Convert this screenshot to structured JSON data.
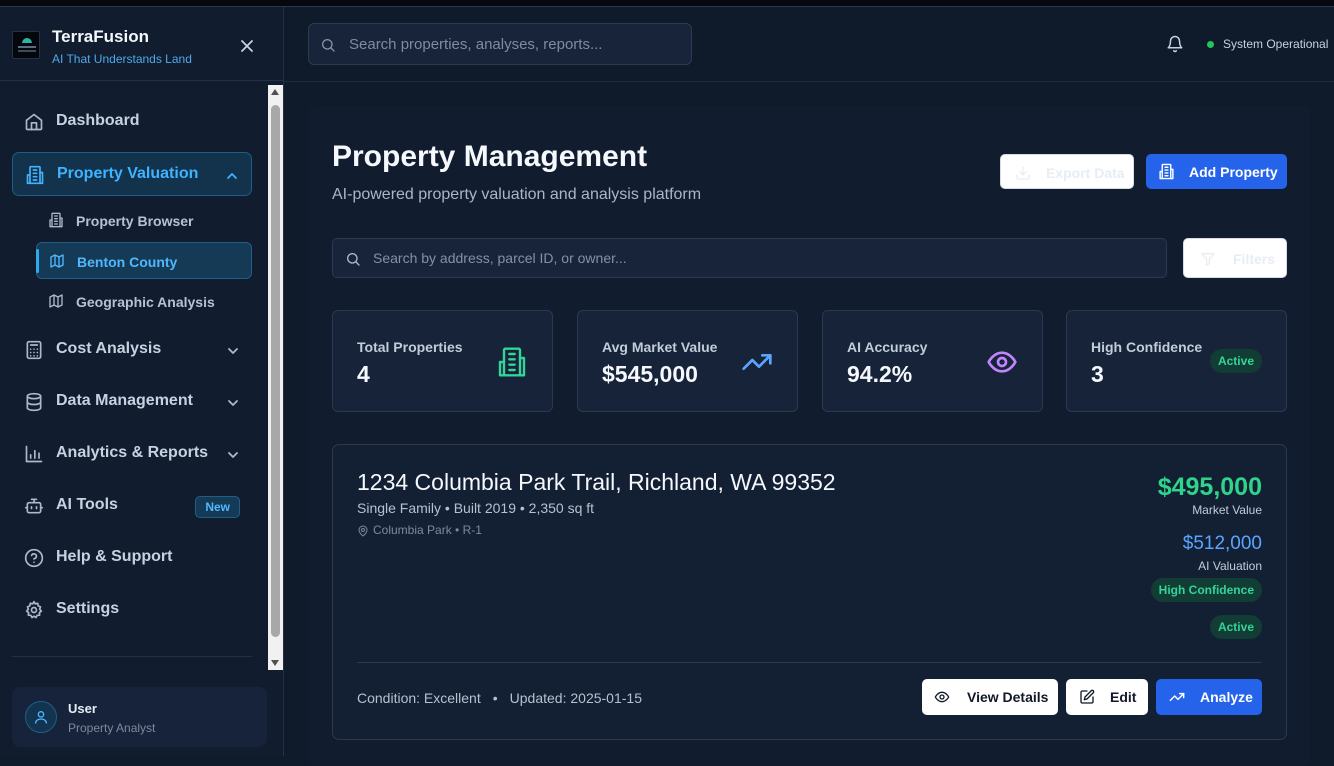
{
  "brand": {
    "title": "TerraFusion",
    "tagline": "AI That Understands Land"
  },
  "sidebar": {
    "items": [
      {
        "label": "Dashboard",
        "icon": "home-icon"
      },
      {
        "label": "Property Valuation",
        "icon": "building-icon",
        "expanded": true,
        "active": true
      },
      {
        "label": "Cost Analysis",
        "icon": "calculator-icon"
      },
      {
        "label": "Data Management",
        "icon": "database-icon"
      },
      {
        "label": "Analytics & Reports",
        "icon": "bar-chart-icon"
      },
      {
        "label": "AI Tools",
        "icon": "bot-icon",
        "badge": "New"
      },
      {
        "label": "Help & Support",
        "icon": "help-circle-icon"
      },
      {
        "label": "Settings",
        "icon": "gear-icon"
      }
    ],
    "subitems": [
      {
        "label": "Property Browser",
        "icon": "building-icon"
      },
      {
        "label": "Benton County",
        "icon": "map-icon",
        "active": true
      },
      {
        "label": "Geographic Analysis",
        "icon": "map-icon"
      }
    ],
    "user": {
      "name": "User",
      "role": "Property Analyst"
    }
  },
  "header": {
    "search_placeholder": "Search properties, analyses, reports...",
    "status": "System Operational",
    "status_color": "#22c55e"
  },
  "main": {
    "title": "Property Management",
    "subtitle": "AI-powered property valuation and analysis platform",
    "export_label": "Export Data",
    "add_label": "Add Property",
    "search_placeholder": "Search by address, parcel ID, or owner...",
    "filters_label": "Filters",
    "stats": [
      {
        "label": "Total Properties",
        "value": "4",
        "icon": "building-icon",
        "color": "#34d399"
      },
      {
        "label": "Avg Market Value",
        "value": "$545,000",
        "icon": "trending-up-icon",
        "color": "#5aa5ff"
      },
      {
        "label": "AI Accuracy",
        "value": "94.2%",
        "icon": "eye-icon",
        "color": "#c084fc"
      },
      {
        "label": "High Confidence",
        "value": "3",
        "badge": "Active"
      }
    ],
    "property": {
      "address": "1234 Columbia Park Trail, Richland, WA 99352",
      "meta": "Single Family • Built 2019 • 2,350 sq ft",
      "location": "Columbia Park • R-1",
      "market_value": "$495,000",
      "market_value_label": "Market Value",
      "ai_value": "$512,000",
      "ai_value_label": "AI Valuation",
      "confidence": "High Confidence",
      "status": "Active",
      "condition": "Condition: Excellent",
      "separator": "•",
      "updated": "Updated: 2025-01-15",
      "view_label": "View Details",
      "edit_label": "Edit",
      "analyze_label": "Analyze"
    }
  },
  "colors": {
    "accent": "#2563eb",
    "active_nav": "#3fb3ff",
    "positive": "#2ed48b",
    "ai_value": "#5aa5ff"
  }
}
